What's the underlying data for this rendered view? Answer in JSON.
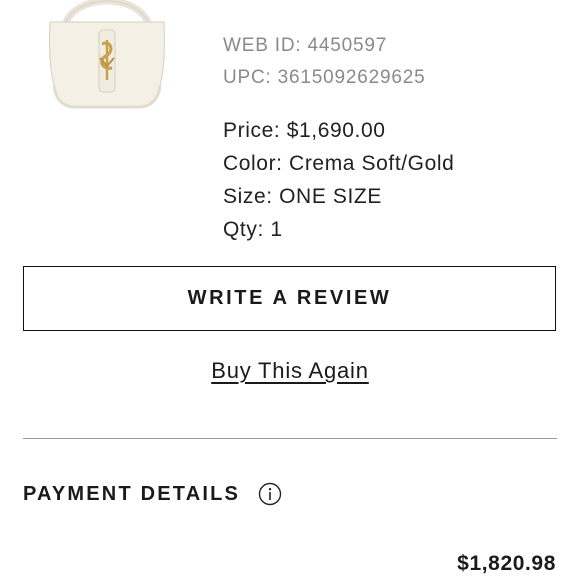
{
  "product": {
    "image_icon": "handbag-icon",
    "web_id": "WEB ID: 4450597",
    "upc": "UPC: 3615092629625",
    "price": "Price: $1,690.00",
    "color": "Color: Crema Soft/Gold",
    "size": "Size: ONE SIZE",
    "qty": "Qty: 1"
  },
  "actions": {
    "write_review_label": "WRITE A REVIEW",
    "buy_again_label": "Buy This Again"
  },
  "payment": {
    "title": "PAYMENT DETAILS",
    "info_icon": "info-icon",
    "total": "$1,820.98"
  },
  "colors": {
    "bag_body": "#f3efe6",
    "bag_hardware": "#c7a24a",
    "text_primary": "#1a1a1a",
    "text_muted": "#8a8a8a"
  }
}
